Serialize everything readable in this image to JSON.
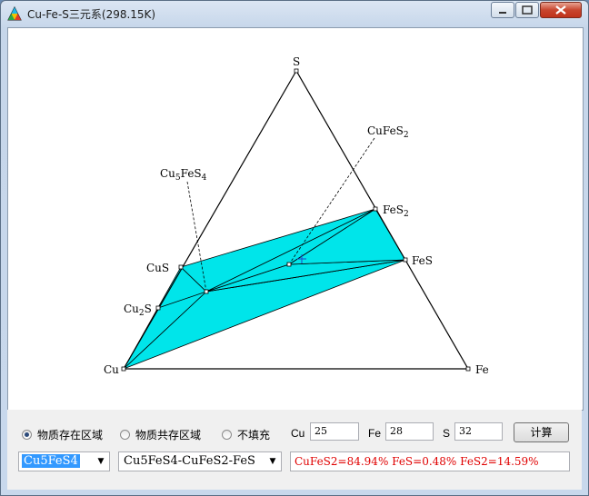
{
  "window": {
    "title": "Cu-Fe-S三元系(298.15K)",
    "accent": "#00e5ea",
    "result_color": "#e00000"
  },
  "diagram": {
    "vertices": {
      "top": "S",
      "left": "Cu",
      "right": "Fe"
    },
    "labels": {
      "cufes2_base": "CuFeS",
      "cufes2_sub": "2",
      "cu5fes4_base": "Cu",
      "cu5fes4_sub1": "5",
      "cu5fes4_mid": "FeS",
      "cu5fes4_sub2": "4",
      "fes2_base": "FeS",
      "fes2_sub": "2",
      "fes": "FeS",
      "cus": "CuS",
      "cu2s_base": "Cu",
      "cu2s_sub": "2",
      "cu2s_end": "S"
    }
  },
  "controls": {
    "radios": [
      {
        "label": "物质存在区域",
        "checked": true
      },
      {
        "label": "物质共存区域",
        "checked": false
      },
      {
        "label": "不填充",
        "checked": false
      }
    ],
    "inputs": [
      {
        "label": "Cu",
        "value": "25"
      },
      {
        "label": "Fe",
        "value": "28"
      },
      {
        "label": "S",
        "value": "32"
      }
    ],
    "calc_button": "计算",
    "combo_compound": "Cu5FeS4",
    "combo_region": "Cu5FeS4-CuFeS2-FeS",
    "result_text": "CuFeS2=84.94% FeS=0.48% FeS2=14.59%"
  }
}
